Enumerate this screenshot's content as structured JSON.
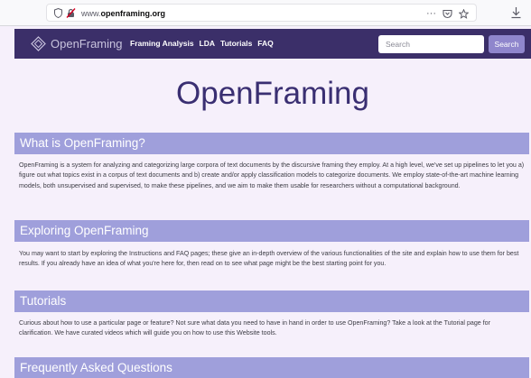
{
  "browser": {
    "url_prefix": "www.",
    "url_domain": "openframing.org",
    "actions": "···"
  },
  "navbar": {
    "brand": "OpenFraming",
    "links": [
      "Framing Analysis",
      "LDA",
      "Tutorials",
      "FAQ"
    ],
    "search_placeholder": "Search",
    "search_button": "Search",
    "colors": {
      "navbar_bg": "#3b2f69",
      "search_button_bg": "#8f86cc"
    }
  },
  "hero": {
    "title": "OpenFraming"
  },
  "sections": [
    {
      "heading": "What is OpenFraming?",
      "body": "OpenFraming is a system for analyzing and categorizing large corpora of text documents by the discursive framing they employ. At a high level, we've set up pipelines to let you a) figure out what topics exist in a corpus of text documents and b) create and/or apply classification models to categorize documents. We employ state-of-the-art machine learning models, both unsupervised and supervised, to make these pipelines, and we aim to make them usable for researchers without a computational background."
    },
    {
      "heading": "Exploring OpenFraming",
      "body": "You may want to start by exploring the Instructions and FAQ pages; these give an in-depth overview of the various functionalities of the site and explain how to use them for best results. If you already have an idea of what you're here for, then read on to see what page might be the best starting point for you."
    },
    {
      "heading": "Tutorials",
      "body": "Curious about how to use a particular page or feature? Not sure what data you need to have in hand in order to use OpenFraming? Take a look at the Tutorial page for clarification. We have curated videos which will guide you on how to use this Website tools."
    },
    {
      "heading": "Frequently Asked Questions",
      "body": ""
    }
  ],
  "colors": {
    "page_bg": "#f6f0fb",
    "section_heading_bg": "#9f9fdb",
    "hero_title": "#3a2f72"
  }
}
